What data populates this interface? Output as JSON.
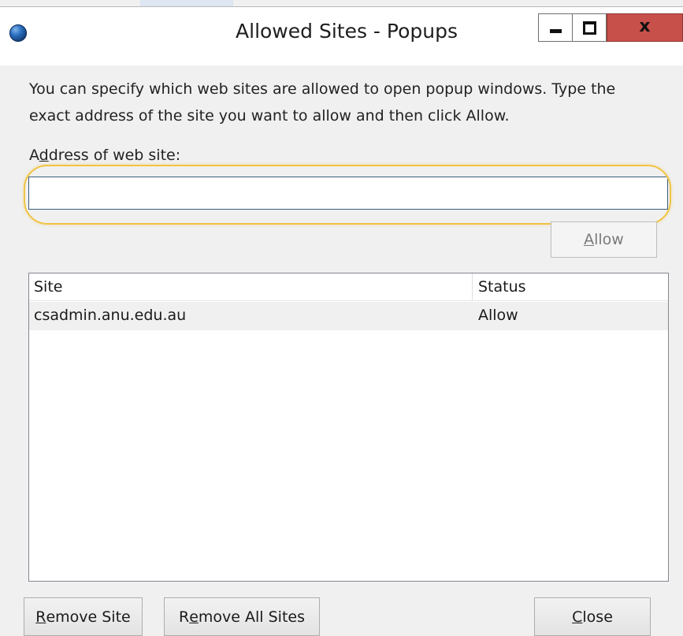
{
  "window": {
    "title": "Allowed Sites - Popups",
    "controls": {
      "minimize": "minimize",
      "maximize": "maximize",
      "close": "x"
    },
    "icon": "globe-icon"
  },
  "dialog": {
    "description": "You can specify which web sites are allowed to open popup windows. Type the exact address of the site you want to allow and then click Allow.",
    "address_label_prefix": "A",
    "address_label_accel": "d",
    "address_label_rest": "dress of web site:",
    "address_value": "",
    "allow_accel": "A",
    "allow_rest": "llow"
  },
  "list": {
    "columns": [
      "Site",
      "Status"
    ],
    "rows": [
      {
        "site": "csadmin.anu.edu.au",
        "status": "Allow"
      }
    ]
  },
  "buttons": {
    "remove_site_accel": "R",
    "remove_site_rest": "emove Site",
    "remove_all_prefix": "R",
    "remove_all_accel": "e",
    "remove_all_rest": "move All Sites",
    "close_accel": "C",
    "close_rest": "lose"
  },
  "colors": {
    "close_button": "#c7504a",
    "highlight": "#f0c445"
  }
}
